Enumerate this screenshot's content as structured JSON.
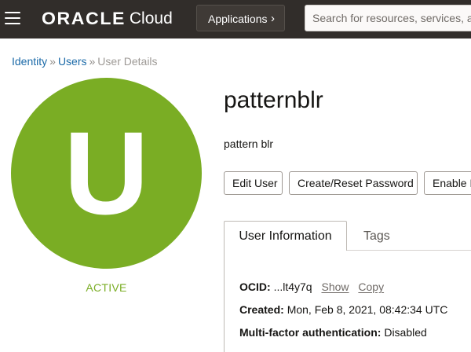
{
  "header": {
    "logo_brand": "ORACLE",
    "logo_product": "Cloud",
    "applications_label": "Applications",
    "search_placeholder": "Search for resources, services, and documentation"
  },
  "breadcrumb": {
    "items": [
      "Identity",
      "Users"
    ],
    "separator": "»",
    "current": "User Details"
  },
  "user": {
    "avatar_letter": "U",
    "avatar_color": "#7aad24",
    "status": "ACTIVE",
    "name": "patternblr",
    "description": "pattern blr"
  },
  "actions": {
    "edit": "Edit User",
    "reset": "Create/Reset Password",
    "enable": "Enable Multi-Factor Authentication"
  },
  "tabs": {
    "user_information": "User Information",
    "tags": "Tags"
  },
  "info": {
    "ocid_label": "OCID:",
    "ocid_value": "...lt4y7q",
    "show_label": "Show",
    "copy_label": "Copy",
    "created_label": "Created:",
    "created_value": "Mon, Feb 8, 2021, 08:42:34 UTC",
    "mfa_label": "Multi-factor authentication:",
    "mfa_value": "Disabled"
  },
  "colors": {
    "topbar": "#312d2a",
    "link": "#1b6aa8",
    "status_green": "#7aad24"
  },
  "icons": {
    "menu": "hamburger-menu-icon",
    "applications_chevron": "chevron-right-icon"
  }
}
